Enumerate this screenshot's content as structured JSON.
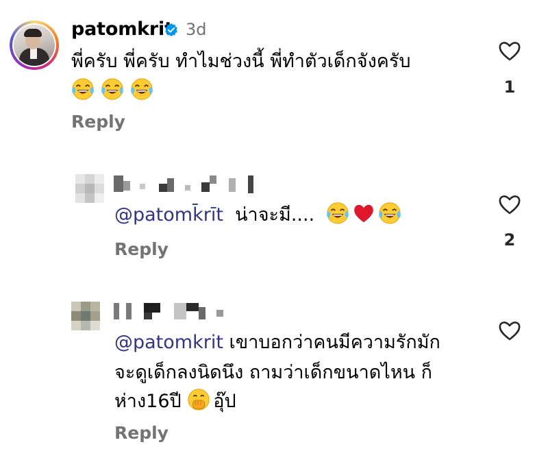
{
  "comments": [
    {
      "username": "patomkrit",
      "time": "3d",
      "text_line1": "พี่ครับ พี่ครับ ทำไมช่วงนี้ พี่ทำตัวเด็กจังครับ",
      "emojis": [
        "joy-emoji",
        "joy-emoji",
        "joy-emoji"
      ],
      "reply_label": "Reply",
      "likes": "1"
    },
    {
      "mention": "@patomk̄rīt",
      "text": "น่าจะมี....",
      "emojis": [
        "joy-emoji",
        "red-heart-emoji",
        "joy-emoji"
      ],
      "reply_label": "Reply",
      "likes": "2"
    },
    {
      "mention": "@patomkrit",
      "text_line1": "เขาบอกว่าคนมีความรักมัก",
      "text_line2": "จะดูเด็กลงนิดนึง ถามว่าเด็กขนาดไหน ก็",
      "text_line3_a": "ห่าง16ปี",
      "text_line3_b": "อุ๊ป",
      "emoji": "hand-over-mouth-emoji",
      "reply_label": "Reply",
      "likes": ""
    }
  ],
  "colors": {
    "secondary_text": "#737373",
    "mention": "#33338a",
    "verified_blue": "#0095f6"
  }
}
